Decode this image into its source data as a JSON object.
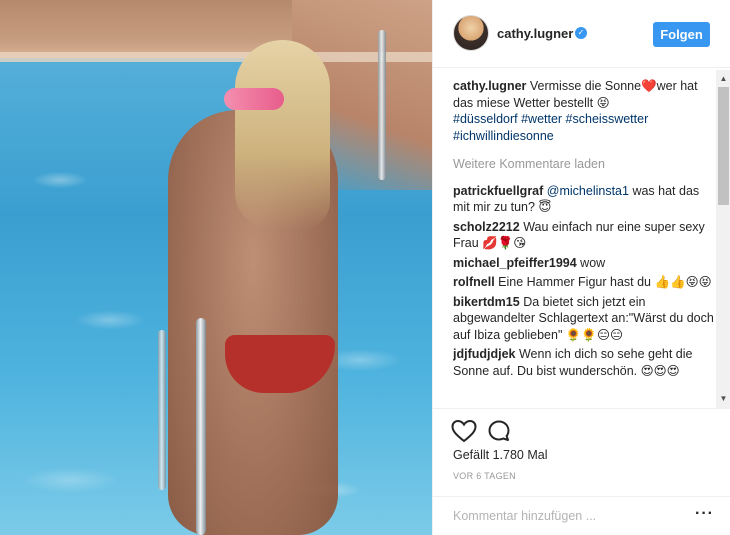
{
  "post": {
    "username": "cathy.lugner",
    "verified_icon": "verified-badge-icon",
    "follow_label": "Folgen",
    "caption": {
      "user": "cathy.lugner",
      "text": " Vermisse die Sonne❤️wer hat das miese Wetter bestellt 😝",
      "hashtags": "#düsseldorf #wetter #scheisswetter #ichwillindiesonne"
    },
    "load_more": "Weitere Kommentare laden",
    "comments": [
      {
        "user": "patrickfuellgraf",
        "mention": "@michelinsta1",
        "text": " was hat das mit mir zu tun? 😇"
      },
      {
        "user": "scholz2212",
        "mention": "",
        "text": "Wau einfach nur eine super sexy Frau 💋🌹😘"
      },
      {
        "user": "michael_pfeiffer1994",
        "mention": "",
        "text": "wow"
      },
      {
        "user": "rolfnell",
        "mention": "",
        "text": "Eine Hammer Figur hast du 👍👍😝😝"
      },
      {
        "user": "bikertdm15",
        "mention": "",
        "text": "Da bietet sich jetzt ein abgewandelter Schlagertext an:\"Wärst du doch auf Ibiza geblieben\" 🌻🌻😑😑"
      },
      {
        "user": "jdjfudjdjek",
        "mention": "",
        "text": "Wenn ich dich so sehe geht die Sonne auf. Du bist wunderschön. 😍😍😍"
      }
    ],
    "likes": "Gefällt 1.780 Mal",
    "time": "VOR 6 TAGEN",
    "comment_placeholder": "Kommentar hinzufügen ...",
    "more_icon": "more-options-icon"
  },
  "colors": {
    "accent": "#3897f0",
    "link": "#003569",
    "muted": "#999999"
  }
}
